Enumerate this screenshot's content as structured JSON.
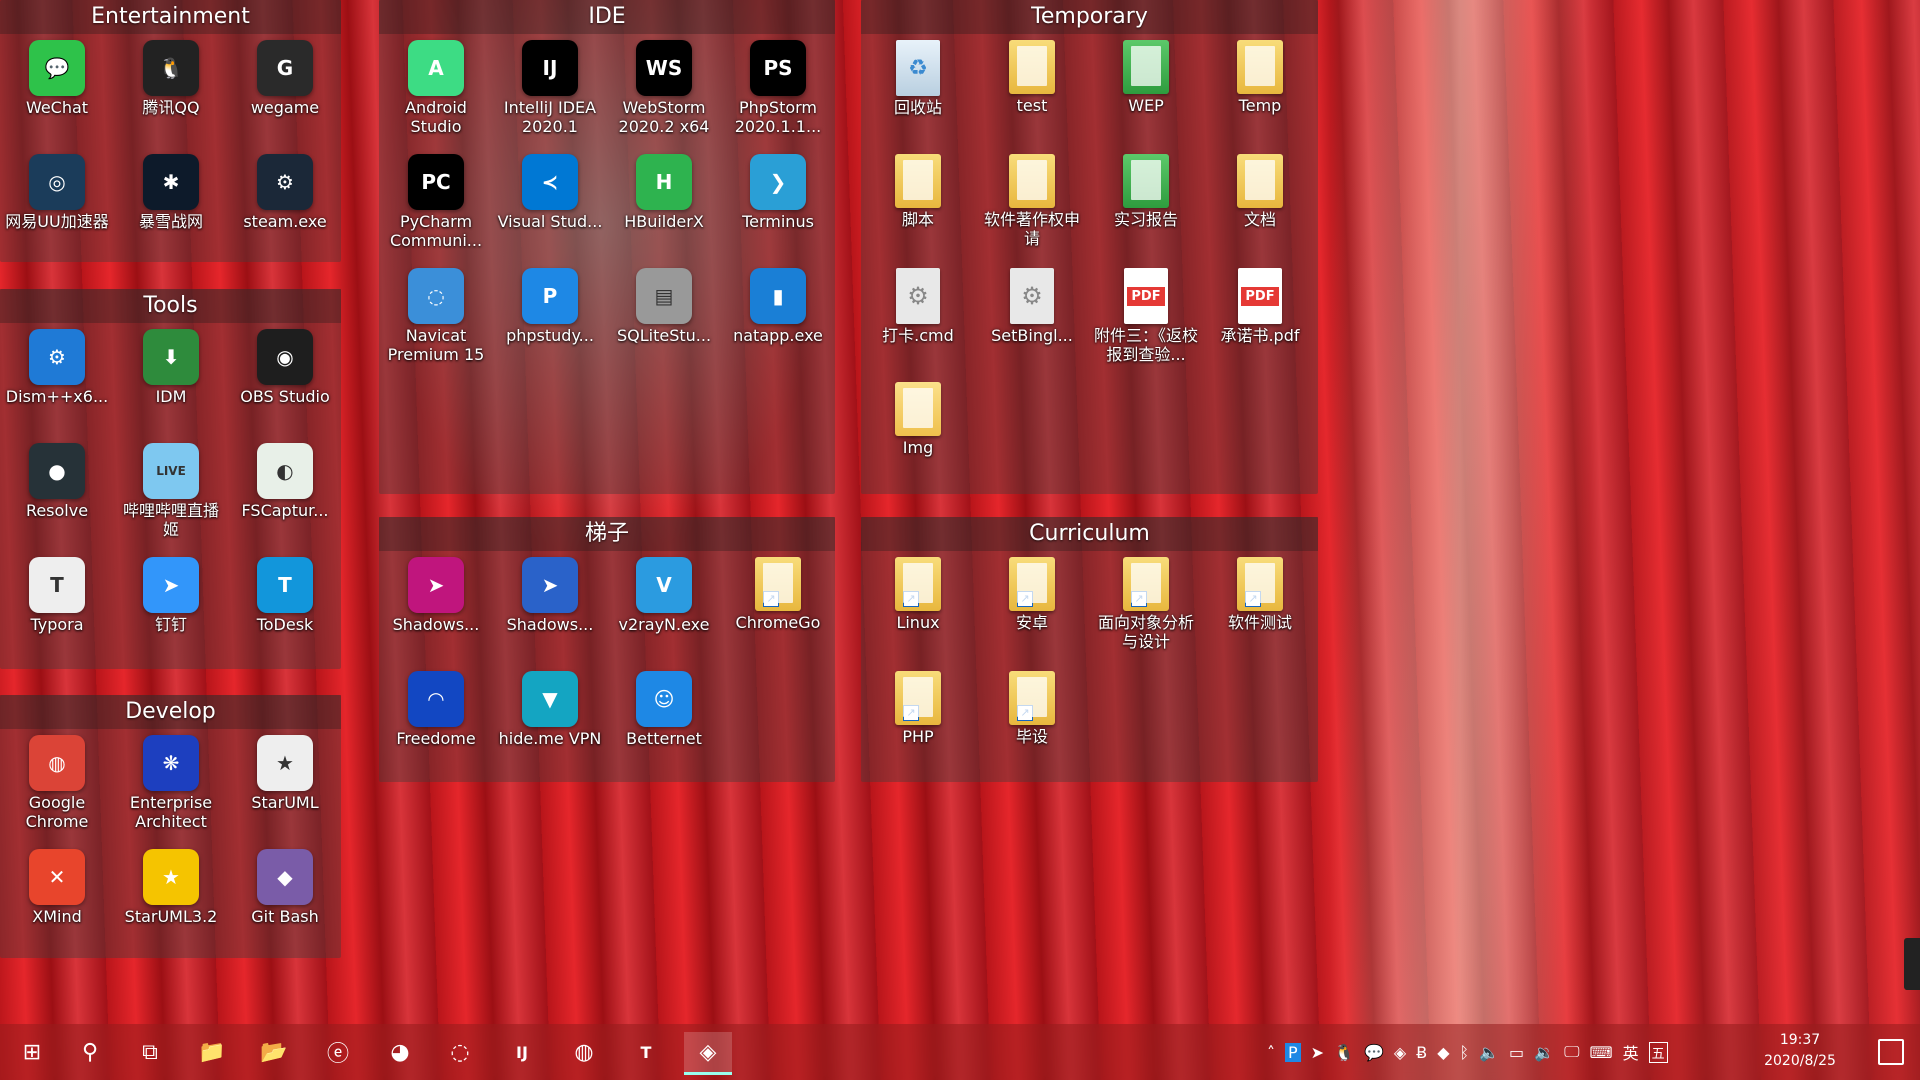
{
  "fences": {
    "entertainment": {
      "title": "Entertainment",
      "items": [
        {
          "label": "WeChat",
          "icon": "wechat-icon",
          "glyph": "💬",
          "color": "#2ec24a"
        },
        {
          "label": "腾讯QQ",
          "icon": "qq-icon",
          "glyph": "🐧",
          "color": "#222222"
        },
        {
          "label": "wegame",
          "icon": "wegame-icon",
          "glyph": "G",
          "color": "#2a2a2a"
        },
        {
          "label": "网易UU加速器",
          "icon": "uu-accelerator-icon",
          "glyph": "◎",
          "color": "#1b3c5a"
        },
        {
          "label": "暴雪战网",
          "icon": "battlenet-icon",
          "glyph": "✱",
          "color": "#0d1a2a"
        },
        {
          "label": "steam.exe",
          "icon": "steam-icon",
          "glyph": "⚙",
          "color": "#1b2838"
        }
      ]
    },
    "tools": {
      "title": "Tools",
      "items": [
        {
          "label": "Dism++x6...",
          "icon": "dism-icon",
          "glyph": "⚙",
          "color": "#1f7ad6"
        },
        {
          "label": "IDM",
          "icon": "idm-icon",
          "glyph": "⬇",
          "color": "#2e8b3c"
        },
        {
          "label": "OBS Studio",
          "icon": "obs-icon",
          "glyph": "◉",
          "color": "#1e1e1e"
        },
        {
          "label": "Resolve",
          "icon": "davinci-resolve-icon",
          "glyph": "●",
          "color": "#263238"
        },
        {
          "label": "哔哩哔哩直播姬",
          "icon": "bilibili-live-icon",
          "glyph": "LIVE",
          "color": "#7ec8f0"
        },
        {
          "label": "FSCaptur...",
          "icon": "fscapture-icon",
          "glyph": "◐",
          "color": "#e8f0e8"
        },
        {
          "label": "Typora",
          "icon": "typora-icon",
          "glyph": "T",
          "color": "#eeeeee"
        },
        {
          "label": "钉钉",
          "icon": "dingtalk-icon",
          "glyph": "➤",
          "color": "#3296fa"
        },
        {
          "label": "ToDesk",
          "icon": "todesk-icon",
          "glyph": "T",
          "color": "#1296db"
        }
      ]
    },
    "develop": {
      "title": "Develop",
      "items": [
        {
          "label": "Google Chrome",
          "icon": "chrome-icon",
          "glyph": "◍",
          "color": "#db4437"
        },
        {
          "label": "Enterprise Architect",
          "icon": "enterprise-architect-icon",
          "glyph": "❋",
          "color": "#1d3fbf"
        },
        {
          "label": "StarUML",
          "icon": "staruml-icon",
          "glyph": "★",
          "color": "#eeeeee"
        },
        {
          "label": "XMind",
          "icon": "xmind-icon",
          "glyph": "✕",
          "color": "#e8452c"
        },
        {
          "label": "StarUML3.2",
          "icon": "staruml-icon",
          "glyph": "★",
          "color": "#f5c400"
        },
        {
          "label": "Git Bash",
          "icon": "git-bash-icon",
          "glyph": "◆",
          "color": "#7a5ca8"
        }
      ]
    },
    "ide": {
      "title": "IDE",
      "items": [
        {
          "label": "Android Studio",
          "icon": "android-studio-icon",
          "glyph": "A",
          "color": "#3ddc84"
        },
        {
          "label": "IntelliJ IDEA 2020.1",
          "icon": "intellij-idea-icon",
          "glyph": "IJ",
          "color": "#000000"
        },
        {
          "label": "WebStorm 2020.2 x64",
          "icon": "webstorm-icon",
          "glyph": "WS",
          "color": "#000000"
        },
        {
          "label": "PhpStorm 2020.1.1...",
          "icon": "phpstorm-icon",
          "glyph": "PS",
          "color": "#000000"
        },
        {
          "label": "PyCharm Communi...",
          "icon": "pycharm-icon",
          "glyph": "PC",
          "color": "#000000"
        },
        {
          "label": "Visual Stud...",
          "icon": "visual-studio-code-icon",
          "glyph": "≺",
          "color": "#0078d4"
        },
        {
          "label": "HBuilderX",
          "icon": "hbuilderx-icon",
          "glyph": "H",
          "color": "#2eb34f"
        },
        {
          "label": "Terminus",
          "icon": "terminus-icon",
          "glyph": "❯",
          "color": "#2a9fd6"
        },
        {
          "label": "Navicat Premium 15",
          "icon": "navicat-icon",
          "glyph": "◌",
          "color": "#3b8fd9"
        },
        {
          "label": "phpstudy...",
          "icon": "phpstudy-icon",
          "glyph": "P",
          "color": "#1e88e5"
        },
        {
          "label": "SQLiteStu...",
          "icon": "sqlitestudio-icon",
          "glyph": "▤",
          "color": "#999999"
        },
        {
          "label": "natapp.exe",
          "icon": "natapp-icon",
          "glyph": "▮",
          "color": "#1a7fd6"
        }
      ]
    },
    "temporary": {
      "title": "Temporary",
      "items": [
        {
          "label": "回收站",
          "icon": "recycle-bin-icon",
          "kind": "bin"
        },
        {
          "label": "test",
          "icon": "folder-icon",
          "kind": "folder"
        },
        {
          "label": "WEP",
          "icon": "folder-icon",
          "kind": "folder-green"
        },
        {
          "label": "Temp",
          "icon": "folder-icon",
          "kind": "folder"
        },
        {
          "label": "脚本",
          "icon": "folder-icon",
          "kind": "folder"
        },
        {
          "label": "软件著作权申请",
          "icon": "folder-icon",
          "kind": "folder"
        },
        {
          "label": "实习报告",
          "icon": "excel-folder-icon",
          "kind": "folder-green"
        },
        {
          "label": "文档",
          "icon": "folder-icon",
          "kind": "folder"
        },
        {
          "label": "打卡.cmd",
          "icon": "cmd-file-icon",
          "kind": "gear"
        },
        {
          "label": "SetBingl...",
          "icon": "settings-file-icon",
          "kind": "gear"
        },
        {
          "label": "附件三：《返校报到查验...",
          "icon": "pdf-file-icon",
          "kind": "pdf"
        },
        {
          "label": "承诺书.pdf",
          "icon": "pdf-file-icon",
          "kind": "pdf"
        },
        {
          "label": "Img",
          "icon": "folder-icon",
          "kind": "folder-plain"
        }
      ]
    },
    "tizi": {
      "title": "梯子",
      "items": [
        {
          "label": "Shadows...",
          "icon": "shadowsocks-icon",
          "glyph": "➤",
          "color": "#c0157d"
        },
        {
          "label": "Shadows...",
          "icon": "shadowsocksr-icon",
          "glyph": "➤",
          "color": "#2a62c9"
        },
        {
          "label": "v2rayN.exe",
          "icon": "v2rayn-icon",
          "glyph": "V",
          "color": "#2b9be0"
        },
        {
          "label": "ChromeGo",
          "icon": "folder-icon",
          "kind": "folder"
        },
        {
          "label": "Freedome",
          "icon": "freedome-icon",
          "glyph": "◠",
          "color": "#1247c2"
        },
        {
          "label": "hide.me VPN",
          "icon": "hideme-vpn-icon",
          "glyph": "▼",
          "color": "#14a5c2"
        },
        {
          "label": "Betternet",
          "icon": "betternet-icon",
          "glyph": "☺",
          "color": "#1e88e5"
        }
      ]
    },
    "curriculum": {
      "title": "Curriculum",
      "items": [
        {
          "label": "Linux",
          "icon": "folder-shortcut-icon",
          "kind": "folder"
        },
        {
          "label": "安卓",
          "icon": "folder-shortcut-icon",
          "kind": "folder"
        },
        {
          "label": "面向对象分析与设计",
          "icon": "folder-shortcut-icon",
          "kind": "folder"
        },
        {
          "label": "软件测试",
          "icon": "folder-shortcut-icon",
          "kind": "folder"
        },
        {
          "label": "PHP",
          "icon": "folder-shortcut-icon",
          "kind": "folder"
        },
        {
          "label": "毕设",
          "icon": "folder-shortcut-icon",
          "kind": "folder"
        }
      ]
    }
  },
  "taskbar": {
    "items": [
      {
        "name": "start-button",
        "glyph": "⊞"
      },
      {
        "name": "search-icon",
        "glyph": "⚲"
      },
      {
        "name": "task-view-icon",
        "glyph": "⧉"
      },
      {
        "name": "file-explorer-icon",
        "glyph": "📁"
      },
      {
        "name": "file-explorer-beta-icon",
        "glyph": "📂"
      },
      {
        "name": "internet-explorer-icon",
        "glyph": "ⓔ"
      },
      {
        "name": "edge-beta-icon",
        "glyph": "◕"
      },
      {
        "name": "navicat-taskbar-icon",
        "glyph": "◌"
      },
      {
        "name": "intellij-taskbar-icon",
        "glyph": "IJ"
      },
      {
        "name": "chrome-taskbar-icon",
        "glyph": "◍"
      },
      {
        "name": "typora-taskbar-icon",
        "glyph": "T"
      },
      {
        "name": "nvidia-taskbar-icon",
        "glyph": "◈"
      }
    ],
    "tray": {
      "ime_lang": "英",
      "ime_mode": "五"
    },
    "clock": {
      "time": "19:37",
      "date": "2020/8/25"
    }
  }
}
